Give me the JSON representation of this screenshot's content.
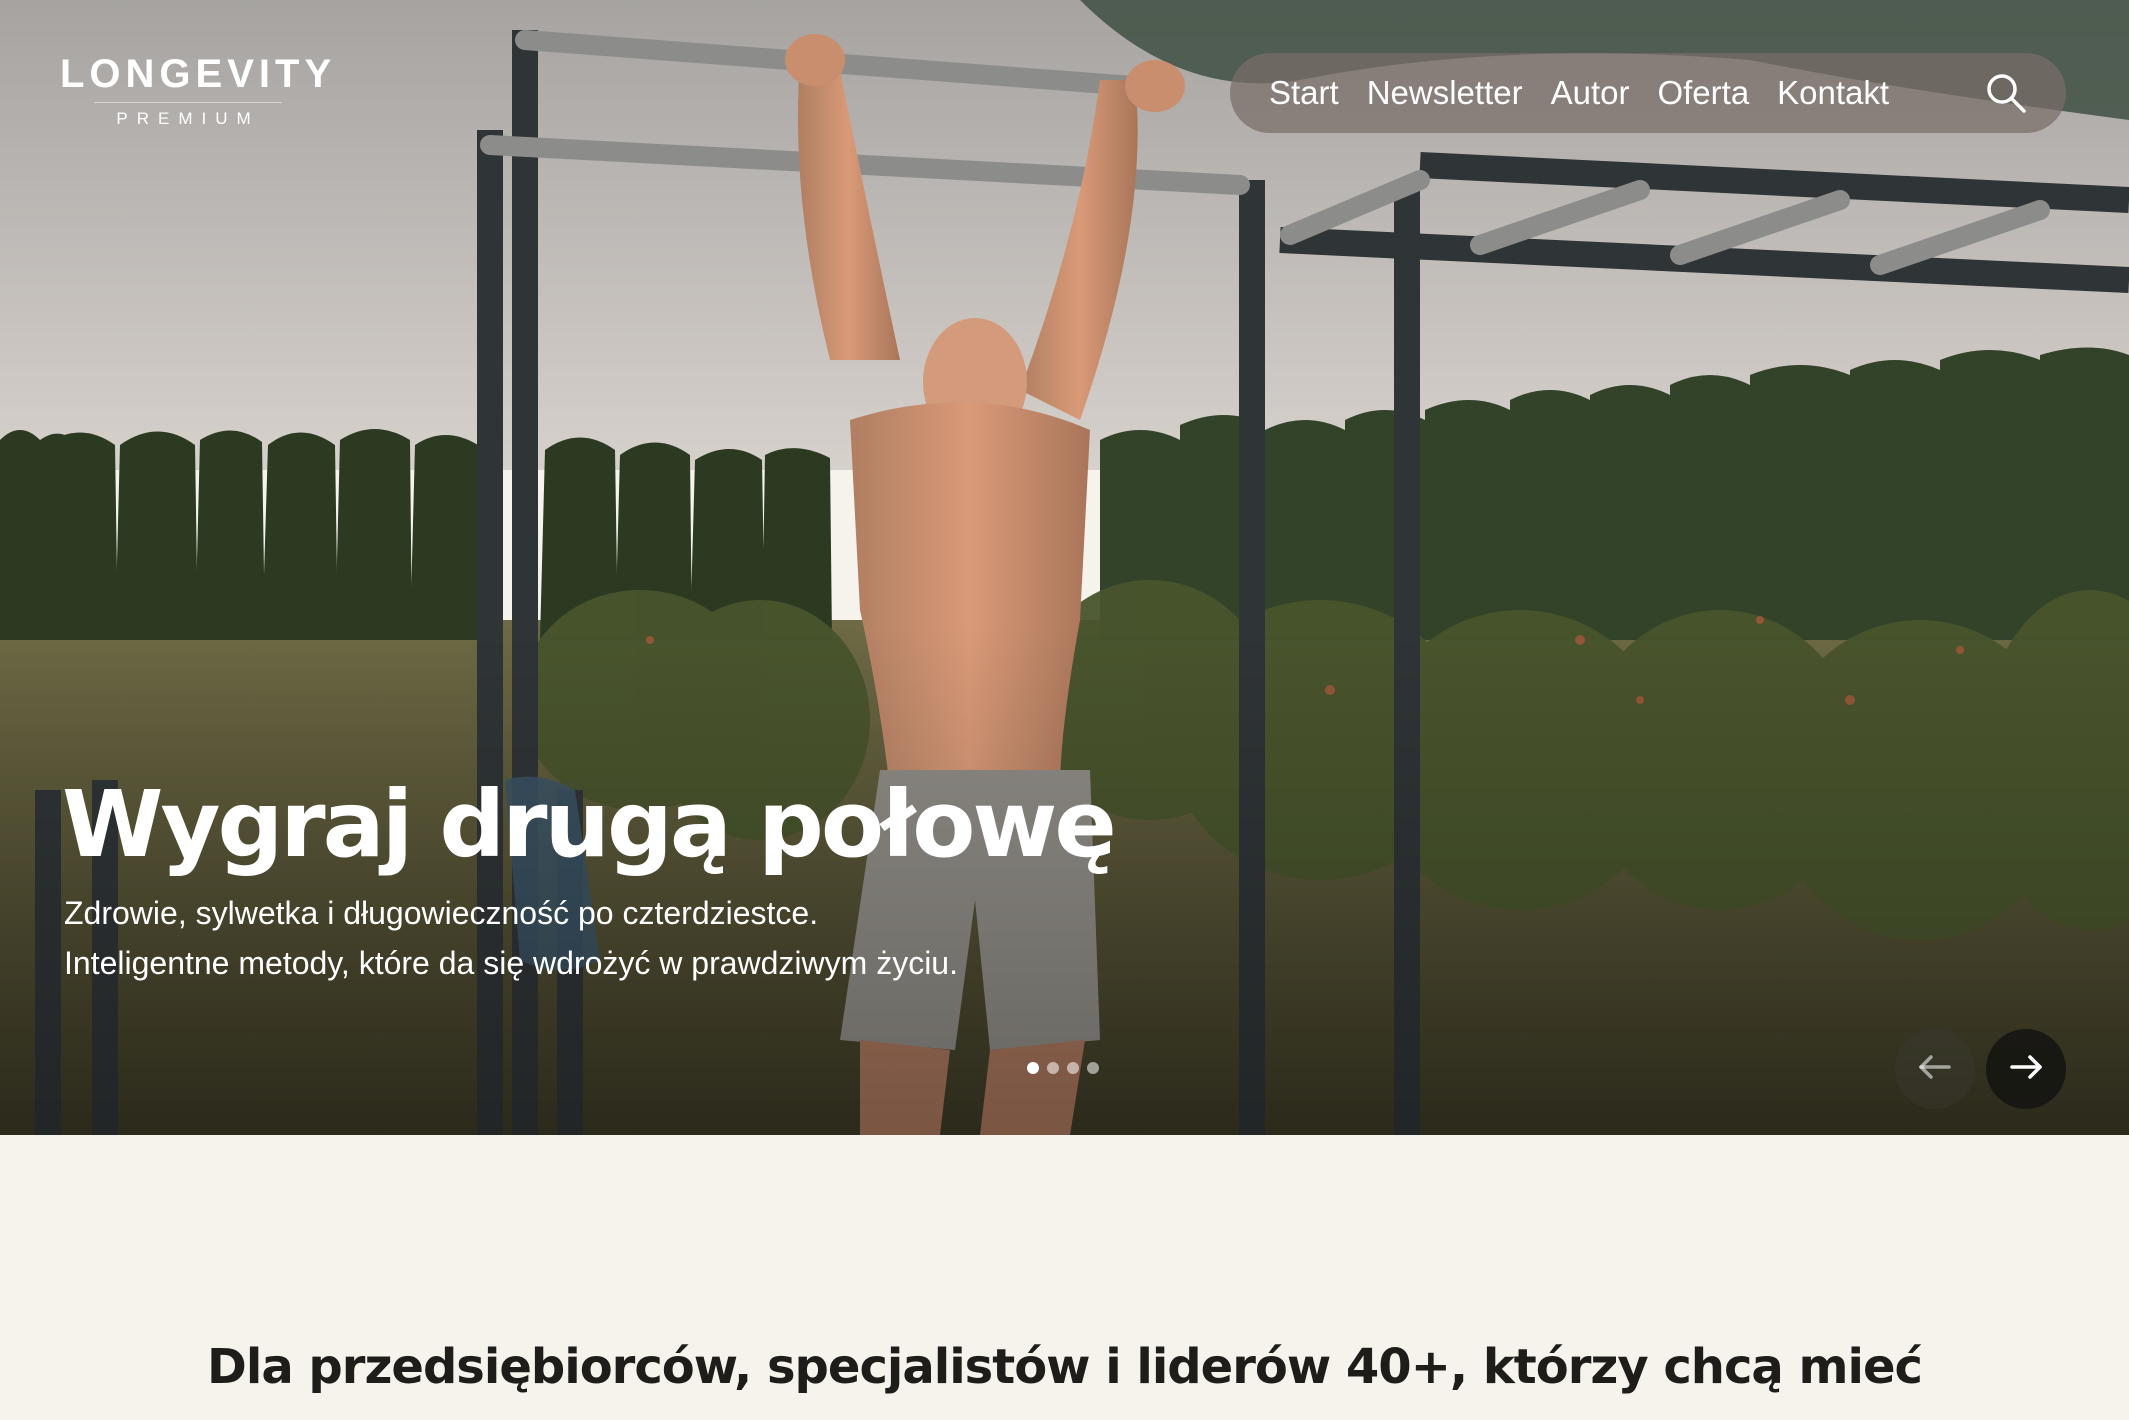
{
  "brand": {
    "name": "LONGEVITY",
    "tagline": "PREMIUM"
  },
  "nav": {
    "items": [
      {
        "label": "Start"
      },
      {
        "label": "Newsletter"
      },
      {
        "label": "Autor"
      },
      {
        "label": "Oferta"
      },
      {
        "label": "Kontakt"
      }
    ],
    "search_icon": "search-icon"
  },
  "hero": {
    "title": "Wygraj drugą połowę",
    "subtitle_line1": "Zdrowie, sylwetka i długowieczność po czterdziestce.",
    "subtitle_line2": "Inteligentne metody, które da się wdrożyć w prawdziwym życiu.",
    "slide_count": 4,
    "active_slide": 1,
    "prev_icon": "arrow-left-icon",
    "next_icon": "arrow-right-icon"
  },
  "intro": {
    "text": "Dla przedsiębiorców, specjalistów i liderów 40+, którzy chcą mieć"
  },
  "colors": {
    "page_bg": "#f6f3ed",
    "nav_bg": "#786e68",
    "text_dark": "#1f1d1a",
    "white": "#ffffff"
  }
}
